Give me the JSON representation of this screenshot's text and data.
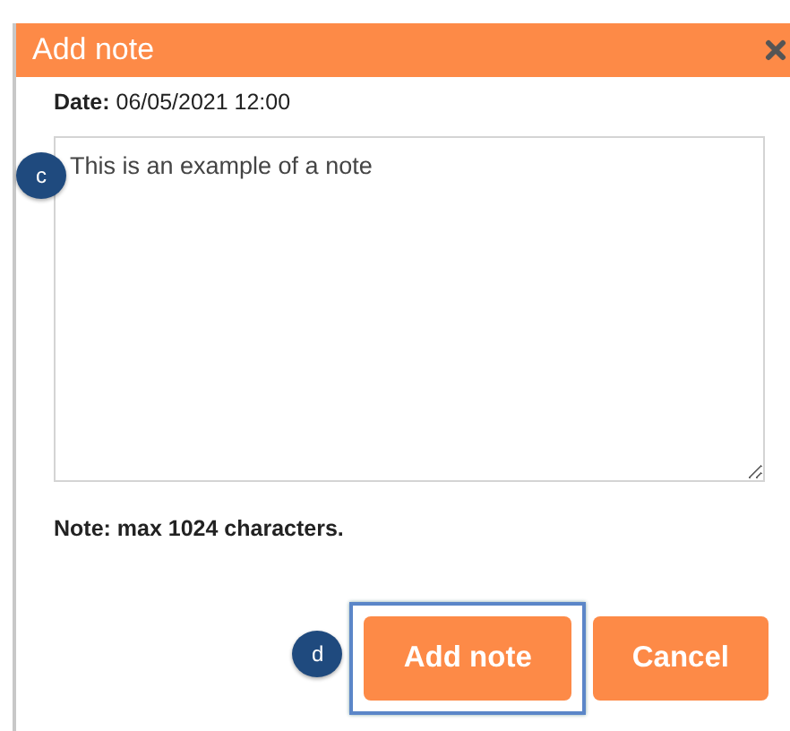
{
  "dialog": {
    "title": "Add note",
    "date_line": "**Date:** 06/05/2021 12:00",
    "note_field": {
      "value": "This is an example of a note",
      "callout": "c"
    },
    "hint": "Note: max 1024 characters.",
    "buttons": [
      {
        "label": "Add note",
        "highlighted": true,
        "callout": "d"
      },
      {
        "label": "Cancel",
        "highlighted": false
      }
    ]
  }
}
